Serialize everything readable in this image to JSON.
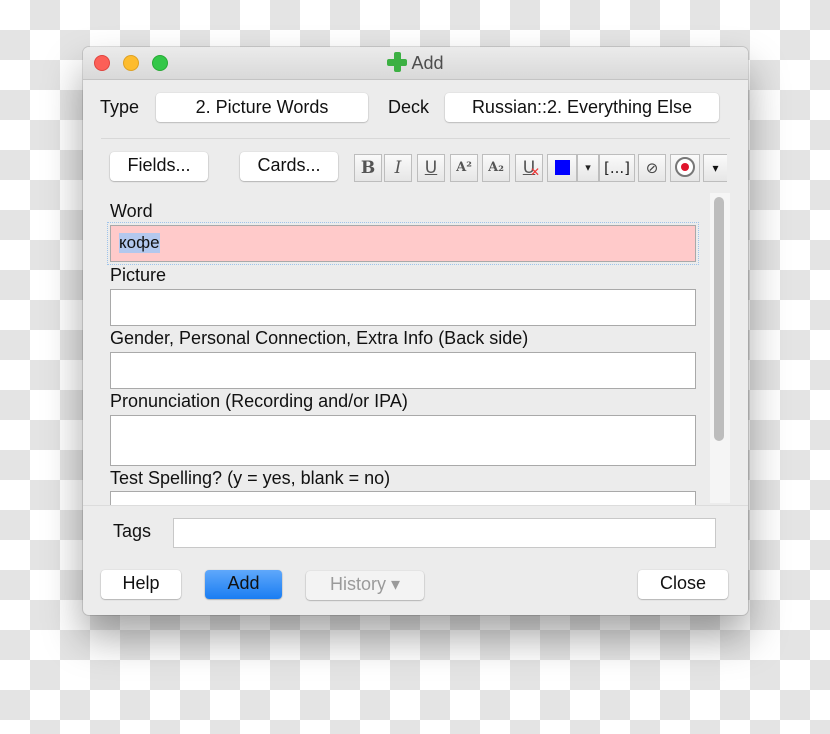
{
  "window": {
    "title": "Add",
    "title_icon": "green-plus-icon"
  },
  "header": {
    "type_label": "Type",
    "type_value": "2. Picture Words",
    "deck_label": "Deck",
    "deck_value": "Russian::2. Everything Else"
  },
  "toolbar": {
    "fields_button": "Fields...",
    "cards_button": "Cards...",
    "format_buttons": [
      {
        "name": "bold",
        "glyph": "B"
      },
      {
        "name": "italic",
        "glyph": "I"
      },
      {
        "name": "underline",
        "glyph": "U"
      },
      {
        "name": "superscript",
        "glyph": "A²"
      },
      {
        "name": "subscript",
        "glyph": "A₂"
      },
      {
        "name": "clear-formatting",
        "glyph": "U"
      },
      {
        "name": "text-color",
        "glyph": "■"
      },
      {
        "name": "text-color-dropdown",
        "glyph": "▾"
      },
      {
        "name": "cloze",
        "glyph": "[...]"
      },
      {
        "name": "attach",
        "glyph": "📎"
      },
      {
        "name": "record",
        "glyph": "●"
      },
      {
        "name": "more",
        "glyph": "▾"
      }
    ],
    "text_color": "#0000ff"
  },
  "fields": [
    {
      "label": "Word",
      "value": "кофе",
      "focused": true
    },
    {
      "label": "Picture",
      "value": ""
    },
    {
      "label": "Gender, Personal Connection, Extra Info (Back side)",
      "value": ""
    },
    {
      "label": "Pronunciation (Recording and/or IPA)",
      "value": ""
    },
    {
      "label": "Test Spelling? (y = yes, blank = no)",
      "value": ""
    }
  ],
  "tags": {
    "label": "Tags",
    "value": ""
  },
  "footer": {
    "help": "Help",
    "add": "Add",
    "history": "History ▾",
    "close": "Close"
  },
  "colors": {
    "focused_field": "#ffcaca",
    "primary_button": "#1a7df2",
    "selection": "#b3c8ee"
  }
}
